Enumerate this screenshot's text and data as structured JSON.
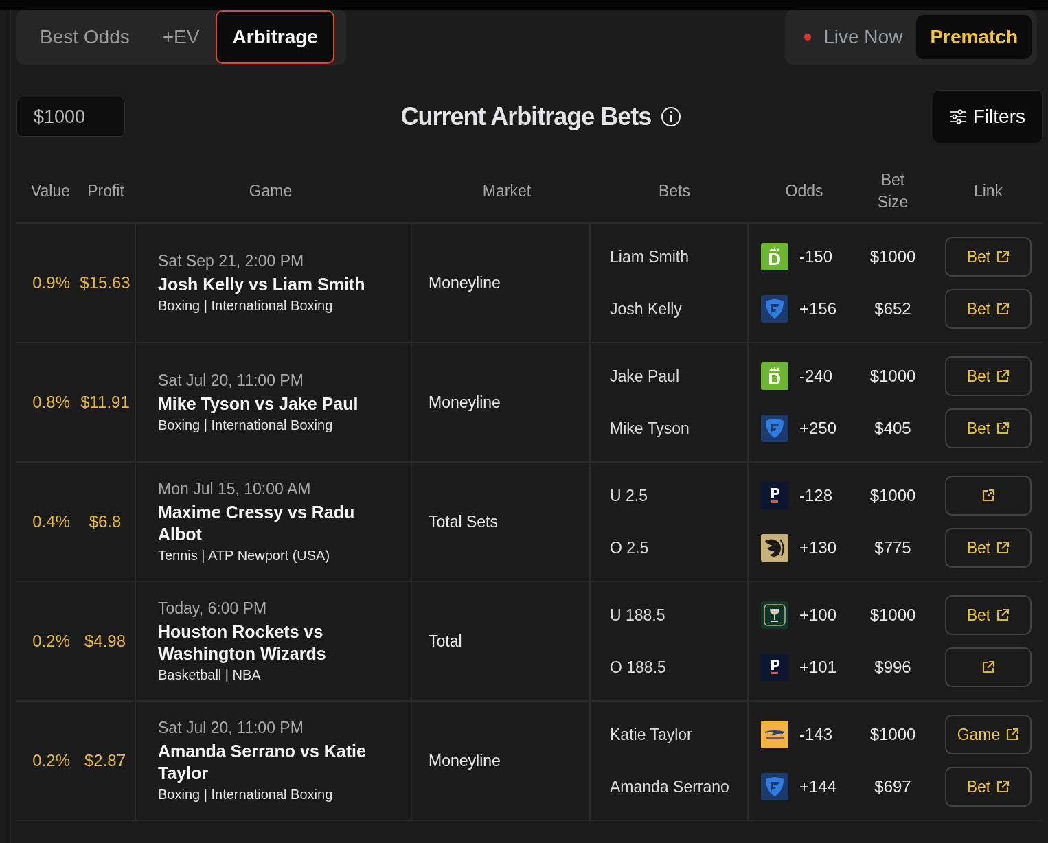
{
  "tabs": [
    {
      "label": "Best Odds",
      "selected": false
    },
    {
      "label": "+EV",
      "selected": false
    },
    {
      "label": "Arbitrage",
      "selected": true
    }
  ],
  "modes": [
    {
      "label": "Live Now",
      "live": true,
      "selected": false
    },
    {
      "label": "Prematch",
      "live": false,
      "selected": true
    }
  ],
  "stake": {
    "value": "$1000"
  },
  "title": "Current Arbitrage Bets",
  "filters_button": "Filters",
  "table": {
    "columns": [
      "Value",
      "Profit",
      "Game",
      "Market",
      "Bets",
      "Odds",
      "Bet Size",
      "Link"
    ],
    "rows": [
      {
        "value": "0.9%",
        "profit": "$15.63",
        "time": "Sat Sep 21, 2:00 PM",
        "game": "Josh Kelly vs Liam Smith",
        "league": "Boxing | International Boxing",
        "market": "Moneyline",
        "bets": [
          {
            "name": "Liam Smith",
            "kind": "draftkings",
            "odds": "-150",
            "size": "$1000",
            "link": "Bet"
          },
          {
            "name": "Josh Kelly",
            "kind": "fanduel",
            "odds": "+156",
            "size": "$652",
            "link": "Bet"
          }
        ]
      },
      {
        "value": "0.8%",
        "profit": "$11.91",
        "time": "Sat Jul 20, 11:00 PM",
        "game": "Mike Tyson vs Jake Paul",
        "league": "Boxing | International Boxing",
        "market": "Moneyline",
        "bets": [
          {
            "name": "Jake Paul",
            "kind": "draftkings",
            "odds": "-240",
            "size": "$1000",
            "link": "Bet"
          },
          {
            "name": "Mike Tyson",
            "kind": "fanduel",
            "odds": "+250",
            "size": "$405",
            "link": "Bet"
          }
        ]
      },
      {
        "value": "0.4%",
        "profit": "$6.8",
        "time": "Mon Jul 15, 10:00 AM",
        "game": "Maxime Cressy vs Radu Albot",
        "league": "Tennis | ATP Newport (USA)",
        "market": "Total Sets",
        "bets": [
          {
            "name": "U 2.5",
            "kind": "pinnacle",
            "odds": "-128",
            "size": "$1000"
          },
          {
            "name": "O 2.5",
            "kind": "betmgm",
            "odds": "+130",
            "size": "$775",
            "link": "Bet"
          }
        ]
      },
      {
        "value": "0.2%",
        "profit": "$4.98",
        "time": "Today, 6:00 PM",
        "game": "Houston Rockets vs Washington Wizards",
        "league": "Basketball | NBA",
        "market": "Total",
        "bets": [
          {
            "name": "U 188.5",
            "kind": "circa",
            "odds": "+100",
            "size": "$1000",
            "link": "Bet"
          },
          {
            "name": "O 188.5",
            "kind": "pinnacle",
            "odds": "+101",
            "size": "$996"
          }
        ]
      },
      {
        "value": "0.2%",
        "profit": "$2.87",
        "time": "Sat Jul 20, 11:00 PM",
        "game": "Amanda Serrano vs Katie Taylor",
        "league": "Boxing | International Boxing",
        "market": "Moneyline",
        "bets": [
          {
            "name": "Katie Taylor",
            "kind": "betrivers",
            "odds": "-143",
            "size": "$1000",
            "link": "Game"
          },
          {
            "name": "Amanda Serrano",
            "kind": "fanduel",
            "odds": "+144",
            "size": "$697",
            "link": "Bet"
          }
        ]
      }
    ]
  }
}
